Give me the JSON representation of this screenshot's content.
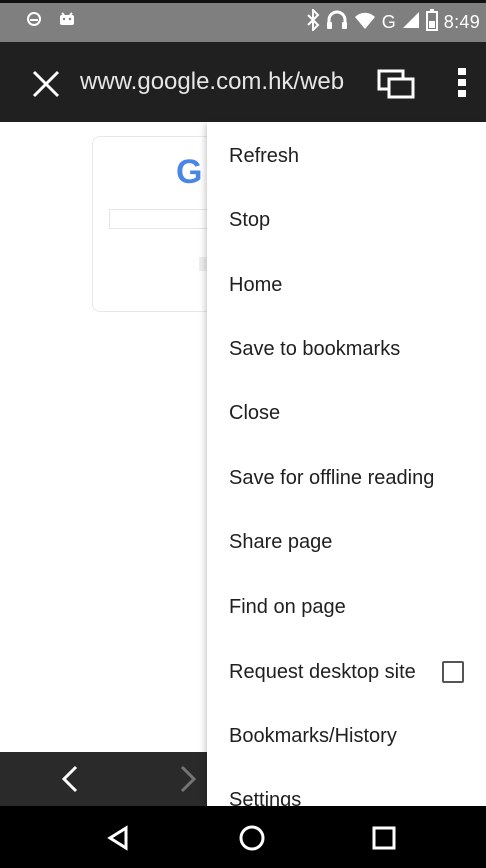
{
  "status_bar": {
    "time": "8:49",
    "left_icons": [
      "sim-icon",
      "android-icon"
    ],
    "right_icons": [
      "bluetooth-icon",
      "headphones-icon",
      "wifi-icon",
      "signal-icon",
      "battery-icon"
    ],
    "network_label": "G"
  },
  "toolbar": {
    "url": "www.google.com.hk/web"
  },
  "page": {
    "google_letter": "G"
  },
  "menu": {
    "items": [
      {
        "label": "Refresh"
      },
      {
        "label": "Stop"
      },
      {
        "label": "Home"
      },
      {
        "label": "Save to bookmarks"
      },
      {
        "label": "Close"
      },
      {
        "label": "Save for offline reading"
      },
      {
        "label": "Share page"
      },
      {
        "label": "Find on page"
      },
      {
        "label": "Request desktop site",
        "checked": false
      },
      {
        "label": "Bookmarks/History"
      },
      {
        "label": "Settings"
      }
    ]
  },
  "colors": {
    "status_bar": "#7f7f7f",
    "toolbar": "#202020",
    "menu_bg": "#ffffff",
    "accent": "#3d8fe0"
  }
}
